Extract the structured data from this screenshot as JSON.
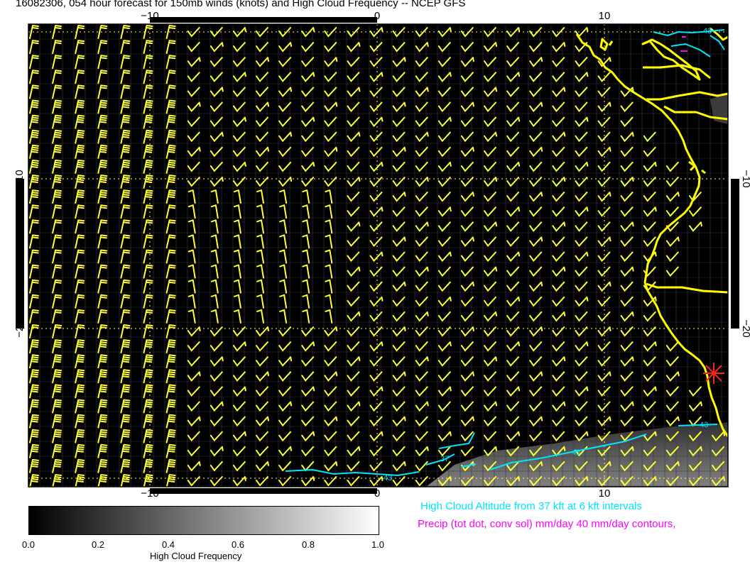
{
  "title": "16082306, 054 hour forecast for 150mb winds (knots) and High Cloud Frequency -- NCEP GFS",
  "map": {
    "lon_ticks": [
      "−10",
      "0",
      "10"
    ],
    "lat_ticks": [
      "−10",
      "−20"
    ],
    "contour_labels": [
      "43",
      "43",
      "43",
      "37",
      "43"
    ],
    "colors": {
      "barb": "#ffff33",
      "coast": "#ffff00",
      "cloud_contour": "#00e5ff",
      "precip": "#ff00ff",
      "marker": "#ff2020",
      "grid": "#ffff66"
    }
  },
  "colorbar": {
    "ticks": [
      "0.0",
      "0.2",
      "0.4",
      "0.6",
      "0.8",
      "1.0"
    ],
    "title": "High Cloud Frequency"
  },
  "legend": {
    "cloud_altitude": "High Cloud Altitude from 37 kft at 6 kft intervals",
    "precip": "Precip (tot dot, conv sol) mm/day 40 mm/day contours,"
  }
}
